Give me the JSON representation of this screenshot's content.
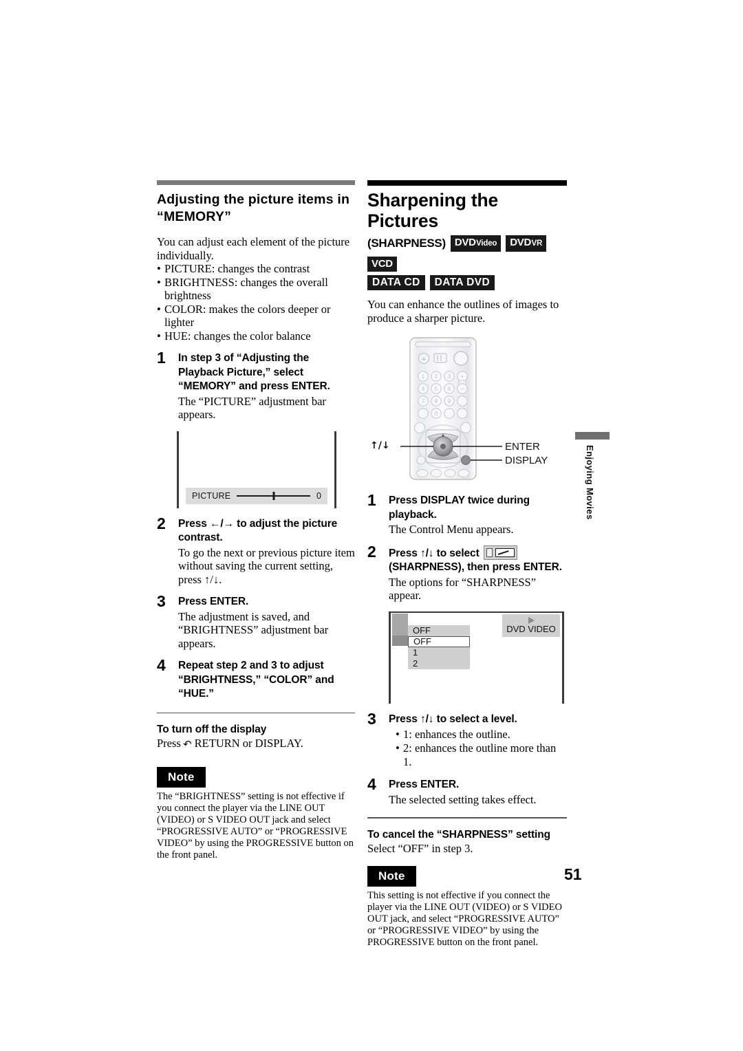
{
  "page": {
    "number": "51",
    "side_tab": "Enjoying Movies"
  },
  "left_column": {
    "title_line1": "Adjusting the picture items in",
    "title_line2": "“MEMORY”",
    "intro": "You can adjust each element of the picture individually.",
    "bullets": [
      "PICTURE: changes the contrast",
      "BRIGHTNESS: changes the overall brightness",
      "COLOR: makes the colors deeper or lighter",
      "HUE: changes the color balance"
    ],
    "steps": [
      {
        "num": "1",
        "head": "In step 3 of “Adjusting the Playback Picture,” select “MEMORY” and press ENTER.",
        "body": "The “PICTURE” adjustment bar appears."
      },
      {
        "num": "2",
        "head": "Press ←/→ to adjust the picture contrast.",
        "body": "To go the next or previous picture item without saving the current setting, press ↑/↓."
      },
      {
        "num": "3",
        "head": "Press ENTER.",
        "body": "The adjustment is saved, and “BRIGHTNESS” adjustment bar appears."
      },
      {
        "num": "4",
        "head": "Repeat step 2 and 3 to adjust “BRIGHTNESS,” “COLOR” and “HUE.”",
        "body": ""
      }
    ],
    "adjustment_bar": {
      "label": "PICTURE",
      "value": "0"
    },
    "turn_off": {
      "head": "To turn off the display",
      "body_pre": "Press ",
      "body_post": " RETURN or DISPLAY."
    },
    "note": {
      "badge": "Note",
      "text": "The “BRIGHTNESS” setting is not effective if you connect the player via the LINE OUT (VIDEO) or S VIDEO OUT jack and select “PROGRESSIVE AUTO” or “PROGRESSIVE VIDEO” by using the PROGRESSIVE button on the front panel."
    }
  },
  "right_column": {
    "title": "Sharpening the Pictures",
    "sharpness_label": "(SHARPNESS)",
    "badges_row1": [
      {
        "main": "DVD",
        "sub": "Video"
      },
      {
        "main": "DVD",
        "sub": "VR"
      },
      {
        "main": "VCD",
        "sub": ""
      }
    ],
    "badges_row2": [
      {
        "main": "DATA CD",
        "sub": ""
      },
      {
        "main": "DATA DVD",
        "sub": ""
      }
    ],
    "intro": "You can enhance the outlines of images to produce a sharper picture.",
    "remote_labels": {
      "updown": "↑/↓",
      "enter": "ENTER",
      "display": "DISPLAY"
    },
    "steps": [
      {
        "num": "1",
        "head": "Press DISPLAY twice during playback.",
        "body": "The Control Menu appears."
      },
      {
        "num": "2",
        "head_pre": "Press ↑/↓ to select",
        "head_post": "(SHARPNESS), then press ENTER.",
        "body": "The options for “SHARPNESS” appear."
      },
      {
        "num": "3",
        "head": "Press ↑/↓ to select a level.",
        "bullets": [
          "1: enhances the outline.",
          "2: enhances the outline more than 1."
        ]
      },
      {
        "num": "4",
        "head": "Press ENTER.",
        "body": "The selected setting takes effect."
      }
    ],
    "osd": {
      "current": "OFF",
      "options": [
        "OFF",
        "1",
        "2"
      ],
      "disc_label": "DVD VIDEO"
    },
    "cancel": {
      "head": "To cancel the “SHARPNESS” setting",
      "body": "Select “OFF” in step 3."
    },
    "note": {
      "badge": "Note",
      "text": "This setting is not effective if you connect the player via the LINE OUT (VIDEO) or S VIDEO OUT jack, and select “PROGRESSIVE AUTO” or “PROGRESSIVE VIDEO” by using the PROGRESSIVE button on the front panel."
    }
  }
}
